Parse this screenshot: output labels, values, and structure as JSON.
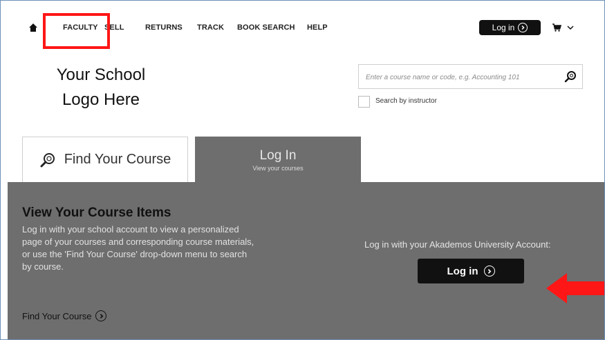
{
  "nav": {
    "items": [
      "FACULTY",
      "SELL",
      "RETURNS",
      "TRACK",
      "BOOK SEARCH",
      "HELP"
    ],
    "login_label": "Log in"
  },
  "logo": {
    "line1": "Your School",
    "line2": "Logo Here"
  },
  "search": {
    "placeholder": "Enter a course name or code, e.g. Accounting 101",
    "by_instructor_label": "Search by instructor"
  },
  "tabs": {
    "find": {
      "label": "Find Your Course"
    },
    "login": {
      "label": "Log In",
      "sub": "View your courses"
    }
  },
  "panel": {
    "title": "View Your Course Items",
    "description": "Log in with your school account to view a personalized page of your courses and corresponding course materials, or use the 'Find Your Course' drop-down menu to search by course.",
    "find_link": "Find Your Course",
    "account_text": "Log in with your Akademos University Account:",
    "login_button": "Log in"
  },
  "colors": {
    "highlight": "#ff1616",
    "panel_bg": "#6e6e6e",
    "button_dark": "#111111"
  },
  "icons": [
    "home-icon",
    "cart-icon",
    "chevron-down-icon",
    "search-icon",
    "chevron-right-icon",
    "arrow-left-icon"
  ]
}
